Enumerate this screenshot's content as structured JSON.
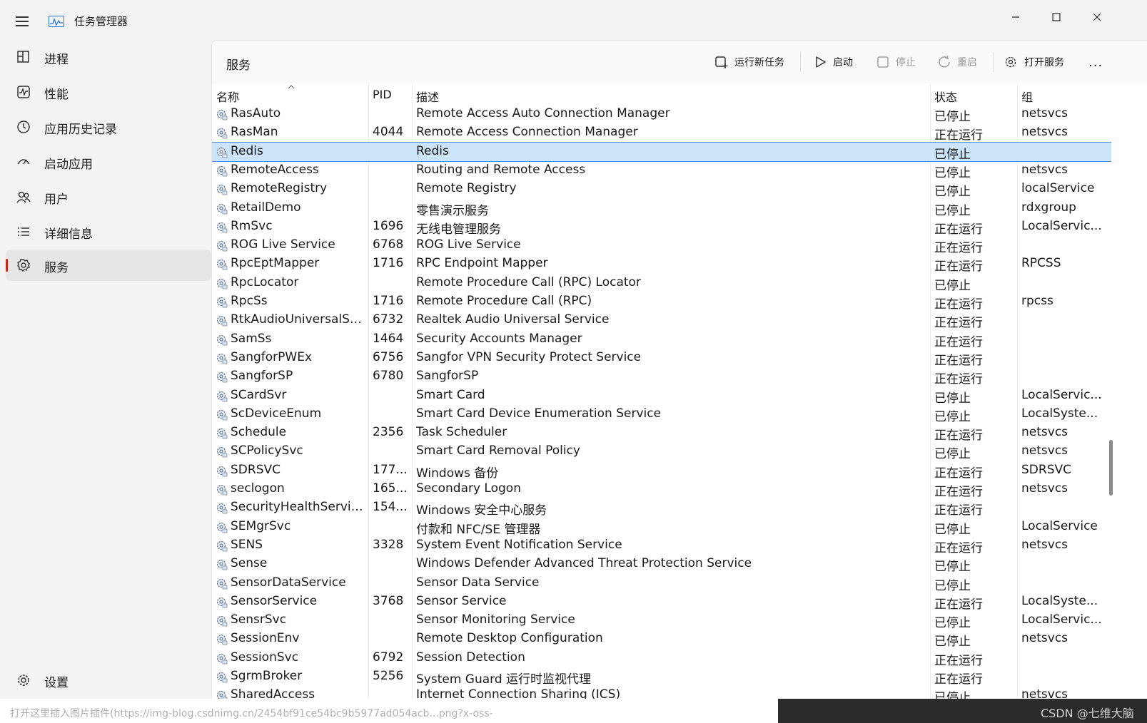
{
  "titlebar": {
    "app_title": "任务管理器"
  },
  "sidebar": {
    "items": [
      {
        "label": "进程",
        "icon": "processes-icon"
      },
      {
        "label": "性能",
        "icon": "performance-icon"
      },
      {
        "label": "应用历史记录",
        "icon": "history-icon"
      },
      {
        "label": "启动应用",
        "icon": "startup-icon"
      },
      {
        "label": "用户",
        "icon": "users-icon"
      },
      {
        "label": "详细信息",
        "icon": "details-icon"
      },
      {
        "label": "服务",
        "icon": "services-icon",
        "active": true
      }
    ],
    "settings_label": "设置"
  },
  "content": {
    "title": "服务",
    "toolbar": {
      "run_new_task": "运行新任务",
      "start": "启动",
      "stop": "停止",
      "restart": "重启",
      "open_services": "打开服务",
      "more": "..."
    }
  },
  "table": {
    "headers": {
      "name": "名称",
      "pid": "PID",
      "description": "描述",
      "status": "状态",
      "group": "组"
    },
    "sort_column": "name",
    "rows": [
      {
        "name": "RasAuto",
        "pid": "",
        "description": "Remote Access Auto Connection Manager",
        "status": "已停止",
        "group": "netsvcs"
      },
      {
        "name": "RasMan",
        "pid": "4044",
        "description": "Remote Access Connection Manager",
        "status": "正在运行",
        "group": "netsvcs"
      },
      {
        "name": "Redis",
        "pid": "",
        "description": "Redis",
        "status": "已停止",
        "group": "",
        "selected": true
      },
      {
        "name": "RemoteAccess",
        "pid": "",
        "description": "Routing and Remote Access",
        "status": "已停止",
        "group": "netsvcs"
      },
      {
        "name": "RemoteRegistry",
        "pid": "",
        "description": "Remote Registry",
        "status": "已停止",
        "group": "localService"
      },
      {
        "name": "RetailDemo",
        "pid": "",
        "description": "零售演示服务",
        "status": "已停止",
        "group": "rdxgroup"
      },
      {
        "name": "RmSvc",
        "pid": "1696",
        "description": "无线电管理服务",
        "status": "正在运行",
        "group": "LocalServic..."
      },
      {
        "name": "ROG Live Service",
        "pid": "6768",
        "description": "ROG Live Service",
        "status": "正在运行",
        "group": ""
      },
      {
        "name": "RpcEptMapper",
        "pid": "1716",
        "description": "RPC Endpoint Mapper",
        "status": "正在运行",
        "group": "RPCSS"
      },
      {
        "name": "RpcLocator",
        "pid": "",
        "description": "Remote Procedure Call (RPC) Locator",
        "status": "已停止",
        "group": ""
      },
      {
        "name": "RpcSs",
        "pid": "1716",
        "description": "Remote Procedure Call (RPC)",
        "status": "正在运行",
        "group": "rpcss"
      },
      {
        "name": "RtkAudioUniversalSer...",
        "pid": "6732",
        "description": "Realtek Audio Universal Service",
        "status": "正在运行",
        "group": ""
      },
      {
        "name": "SamSs",
        "pid": "1464",
        "description": "Security Accounts Manager",
        "status": "正在运行",
        "group": ""
      },
      {
        "name": "SangforPWEx",
        "pid": "6756",
        "description": "Sangfor VPN Security Protect Service",
        "status": "正在运行",
        "group": ""
      },
      {
        "name": "SangforSP",
        "pid": "6780",
        "description": "SangforSP",
        "status": "正在运行",
        "group": ""
      },
      {
        "name": "SCardSvr",
        "pid": "",
        "description": "Smart Card",
        "status": "已停止",
        "group": "LocalServic..."
      },
      {
        "name": "ScDeviceEnum",
        "pid": "",
        "description": "Smart Card Device Enumeration Service",
        "status": "已停止",
        "group": "LocalSyste..."
      },
      {
        "name": "Schedule",
        "pid": "2356",
        "description": "Task Scheduler",
        "status": "正在运行",
        "group": "netsvcs"
      },
      {
        "name": "SCPolicySvc",
        "pid": "",
        "description": "Smart Card Removal Policy",
        "status": "已停止",
        "group": "netsvcs"
      },
      {
        "name": "SDRSVC",
        "pid": "177...",
        "description": "Windows 备份",
        "status": "正在运行",
        "group": "SDRSVC"
      },
      {
        "name": "seclogon",
        "pid": "165...",
        "description": "Secondary Logon",
        "status": "正在运行",
        "group": "netsvcs"
      },
      {
        "name": "SecurityHealthService",
        "pid": "154...",
        "description": "Windows 安全中心服务",
        "status": "正在运行",
        "group": ""
      },
      {
        "name": "SEMgrSvc",
        "pid": "",
        "description": "付款和 NFC/SE 管理器",
        "status": "已停止",
        "group": "LocalService"
      },
      {
        "name": "SENS",
        "pid": "3328",
        "description": "System Event Notification Service",
        "status": "正在运行",
        "group": "netsvcs"
      },
      {
        "name": "Sense",
        "pid": "",
        "description": "Windows Defender Advanced Threat Protection Service",
        "status": "已停止",
        "group": ""
      },
      {
        "name": "SensorDataService",
        "pid": "",
        "description": "Sensor Data Service",
        "status": "已停止",
        "group": ""
      },
      {
        "name": "SensorService",
        "pid": "3768",
        "description": "Sensor Service",
        "status": "正在运行",
        "group": "LocalSyste..."
      },
      {
        "name": "SensrSvc",
        "pid": "",
        "description": "Sensor Monitoring Service",
        "status": "已停止",
        "group": "LocalServic..."
      },
      {
        "name": "SessionEnv",
        "pid": "",
        "description": "Remote Desktop Configuration",
        "status": "已停止",
        "group": "netsvcs"
      },
      {
        "name": "SessionSvc",
        "pid": "6792",
        "description": "Session Detection",
        "status": "正在运行",
        "group": ""
      },
      {
        "name": "SgrmBroker",
        "pid": "5256",
        "description": "System Guard 运行时监视代理",
        "status": "正在运行",
        "group": ""
      },
      {
        "name": "SharedAccess",
        "pid": "",
        "description": "Internet Connection Sharing (ICS)",
        "status": "已停止",
        "group": "netsvcs"
      }
    ]
  },
  "footer": {
    "overlay_text": "打开这里插入图片插件(https://img-blog.csdnimg.cn/2454bf91ce54bc9b5977ad054acb...png?x-oss-",
    "watermark": "CSDN @七维大脑"
  },
  "colors": {
    "selection": "#cce4f7",
    "selection_border": "#4c8ed8",
    "active_indicator": "#c42b1c"
  }
}
